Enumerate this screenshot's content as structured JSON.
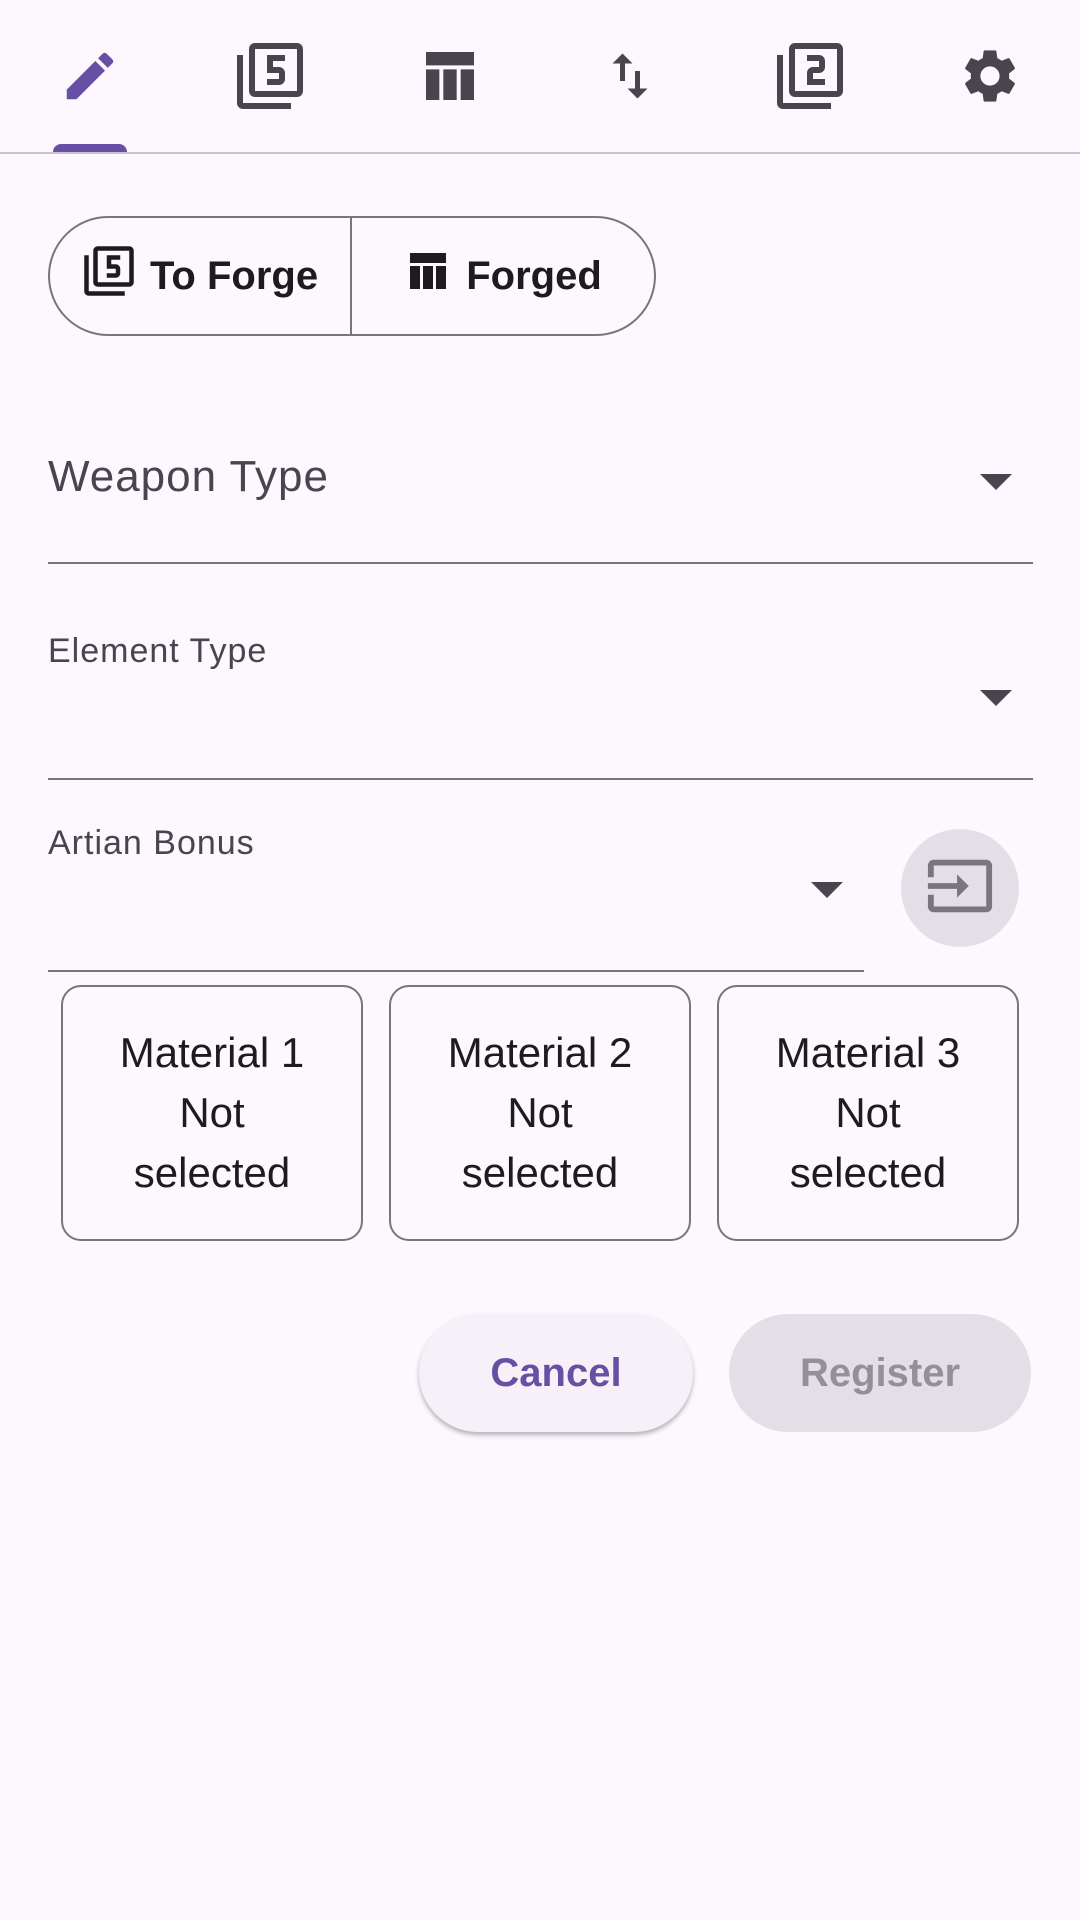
{
  "colors": {
    "background": "#fdf7fe",
    "accent": "#6750a4",
    "icon": "#49454f",
    "outline": "#79747e",
    "disabled_bg": "#e4dfe6",
    "disabled_text": "#948f99"
  },
  "tabs": [
    {
      "icon": "pencil-icon",
      "selected": true
    },
    {
      "icon": "filter-5-icon",
      "selected": false
    },
    {
      "icon": "table-icon",
      "selected": false
    },
    {
      "icon": "swap-vert-icon",
      "selected": false
    },
    {
      "icon": "filter-2-icon",
      "selected": false
    },
    {
      "icon": "gear-icon",
      "selected": false
    }
  ],
  "segmented": {
    "selected": "to_forge",
    "to_forge": {
      "label": "To Forge",
      "icon": "filter-5-icon"
    },
    "forged": {
      "label": "Forged",
      "icon": "table-icon"
    }
  },
  "form": {
    "weapon_type": {
      "placeholder": "Weapon Type",
      "value": ""
    },
    "element_type": {
      "label": "Element Type",
      "value": ""
    },
    "artian_bonus": {
      "label": "Artian Bonus",
      "value": "",
      "apply_icon": "input-icon"
    }
  },
  "materials": [
    {
      "title": "Material 1",
      "status": [
        "Not",
        "selected"
      ]
    },
    {
      "title": "Material 2",
      "status": [
        "Not",
        "selected"
      ]
    },
    {
      "title": "Material 3",
      "status": [
        "Not",
        "selected"
      ]
    }
  ],
  "actions": {
    "cancel_label": "Cancel",
    "register_label": "Register",
    "register_enabled": false
  }
}
